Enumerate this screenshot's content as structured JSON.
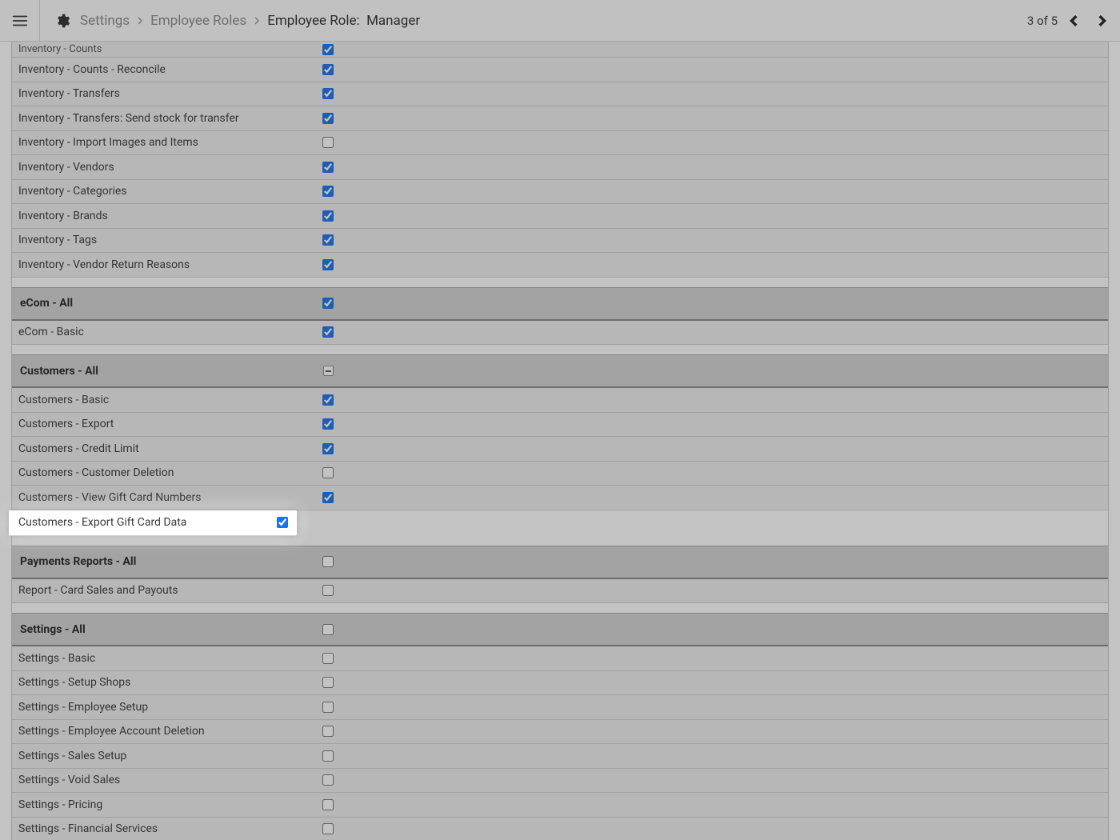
{
  "header": {
    "breadcrumb": {
      "settings": "Settings",
      "roles": "Employee Roles",
      "current_prefix": "Employee Role:",
      "current_value": "Manager"
    },
    "pager": {
      "text": "3 of 5"
    }
  },
  "groups": [
    {
      "id": "inventory",
      "show_header": false,
      "first_clipped": {
        "label": "Inventory - Counts",
        "state": "checked"
      },
      "rows": [
        {
          "label": "Inventory - Counts - Reconcile",
          "state": "checked"
        },
        {
          "label": "Inventory - Transfers",
          "state": "checked"
        },
        {
          "label": "Inventory - Transfers: Send stock for transfer",
          "state": "checked"
        },
        {
          "label": "Inventory - Import Images and Items",
          "state": "unchecked"
        },
        {
          "label": "Inventory - Vendors",
          "state": "checked"
        },
        {
          "label": "Inventory - Categories",
          "state": "checked"
        },
        {
          "label": "Inventory - Brands",
          "state": "checked"
        },
        {
          "label": "Inventory - Tags",
          "state": "checked"
        },
        {
          "label": "Inventory - Vendor Return Reasons",
          "state": "checked"
        }
      ]
    },
    {
      "id": "ecom",
      "header": "eCom - All",
      "header_state": "checked",
      "rows": [
        {
          "label": "eCom - Basic",
          "state": "checked"
        }
      ]
    },
    {
      "id": "customers",
      "header": "Customers - All",
      "header_state": "indeterminate",
      "rows": [
        {
          "label": "Customers - Basic",
          "state": "checked"
        },
        {
          "label": "Customers - Export",
          "state": "checked"
        },
        {
          "label": "Customers - Credit Limit",
          "state": "checked"
        },
        {
          "label": "Customers - Customer Deletion",
          "state": "unchecked"
        },
        {
          "label": "Customers - View Gift Card Numbers",
          "state": "checked"
        },
        {
          "label": "Customers - Export Gift Card Data",
          "state": "checked",
          "highlight": true
        }
      ]
    },
    {
      "id": "payments",
      "header": "Payments Reports - All",
      "header_state": "unchecked",
      "rows": [
        {
          "label": "Report - Card Sales and Payouts",
          "state": "unchecked"
        }
      ]
    },
    {
      "id": "settings",
      "header": "Settings - All",
      "header_state": "unchecked",
      "rows": [
        {
          "label": "Settings - Basic",
          "state": "unchecked"
        },
        {
          "label": "Settings - Setup Shops",
          "state": "unchecked"
        },
        {
          "label": "Settings - Employee Setup",
          "state": "unchecked"
        },
        {
          "label": "Settings - Employee Account Deletion",
          "state": "unchecked"
        },
        {
          "label": "Settings - Sales Setup",
          "state": "unchecked"
        },
        {
          "label": "Settings - Void Sales",
          "state": "unchecked"
        },
        {
          "label": "Settings - Pricing",
          "state": "unchecked"
        },
        {
          "label": "Settings - Financial Services",
          "state": "unchecked"
        }
      ]
    }
  ]
}
